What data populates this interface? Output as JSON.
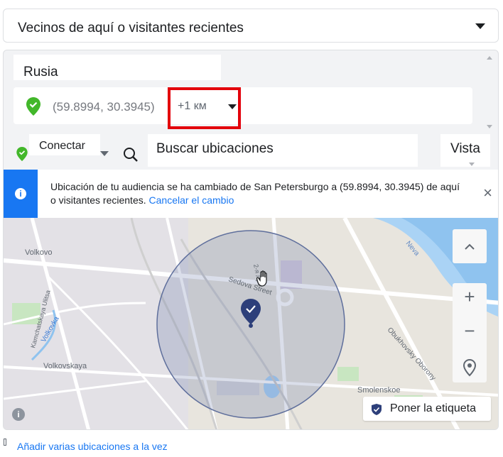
{
  "audience_select": {
    "label": "Vecinos de aquí o visitantes recientes",
    "icon": "chevron-down-icon"
  },
  "location": {
    "country": "Rusia",
    "coordinates": "(59.8994, 30.3945)",
    "radius": "+1 км",
    "pin_color": "#42b72a",
    "highlight_color": "#e3000b"
  },
  "toolbar": {
    "mode_label": "Conectar",
    "search_label": "Buscar ubicaciones",
    "view_label": "Vista"
  },
  "notice": {
    "text": "Ubicación de tu audiencia se ha cambiado de San Petersburgo a (59.8994, 30.3945) de aquí o visitantes recientes.",
    "cancel_link": "Cancelar el cambio",
    "accent_color": "#1877f2"
  },
  "map": {
    "labels": {
      "volkovo": "Volkovo",
      "volkovka": "Volkovka",
      "volkovskaya": "Volkovskaya",
      "sedova": "Sedova Street",
      "neva": "Neva",
      "obukhovsky": "Obukhovsky Oborony",
      "smolenskoe": "Smolenskoe",
      "kamchatskaya": "Kamchatskaya Ulitsa",
      "street_2": "2-я Луч"
    },
    "controls": {
      "plus": "+",
      "minus": "−",
      "up": "^"
    },
    "tag_button": "Poner la etiqueta"
  },
  "footer": {
    "add_multiple_link": "Añadir varias ubicaciones a la vez"
  }
}
